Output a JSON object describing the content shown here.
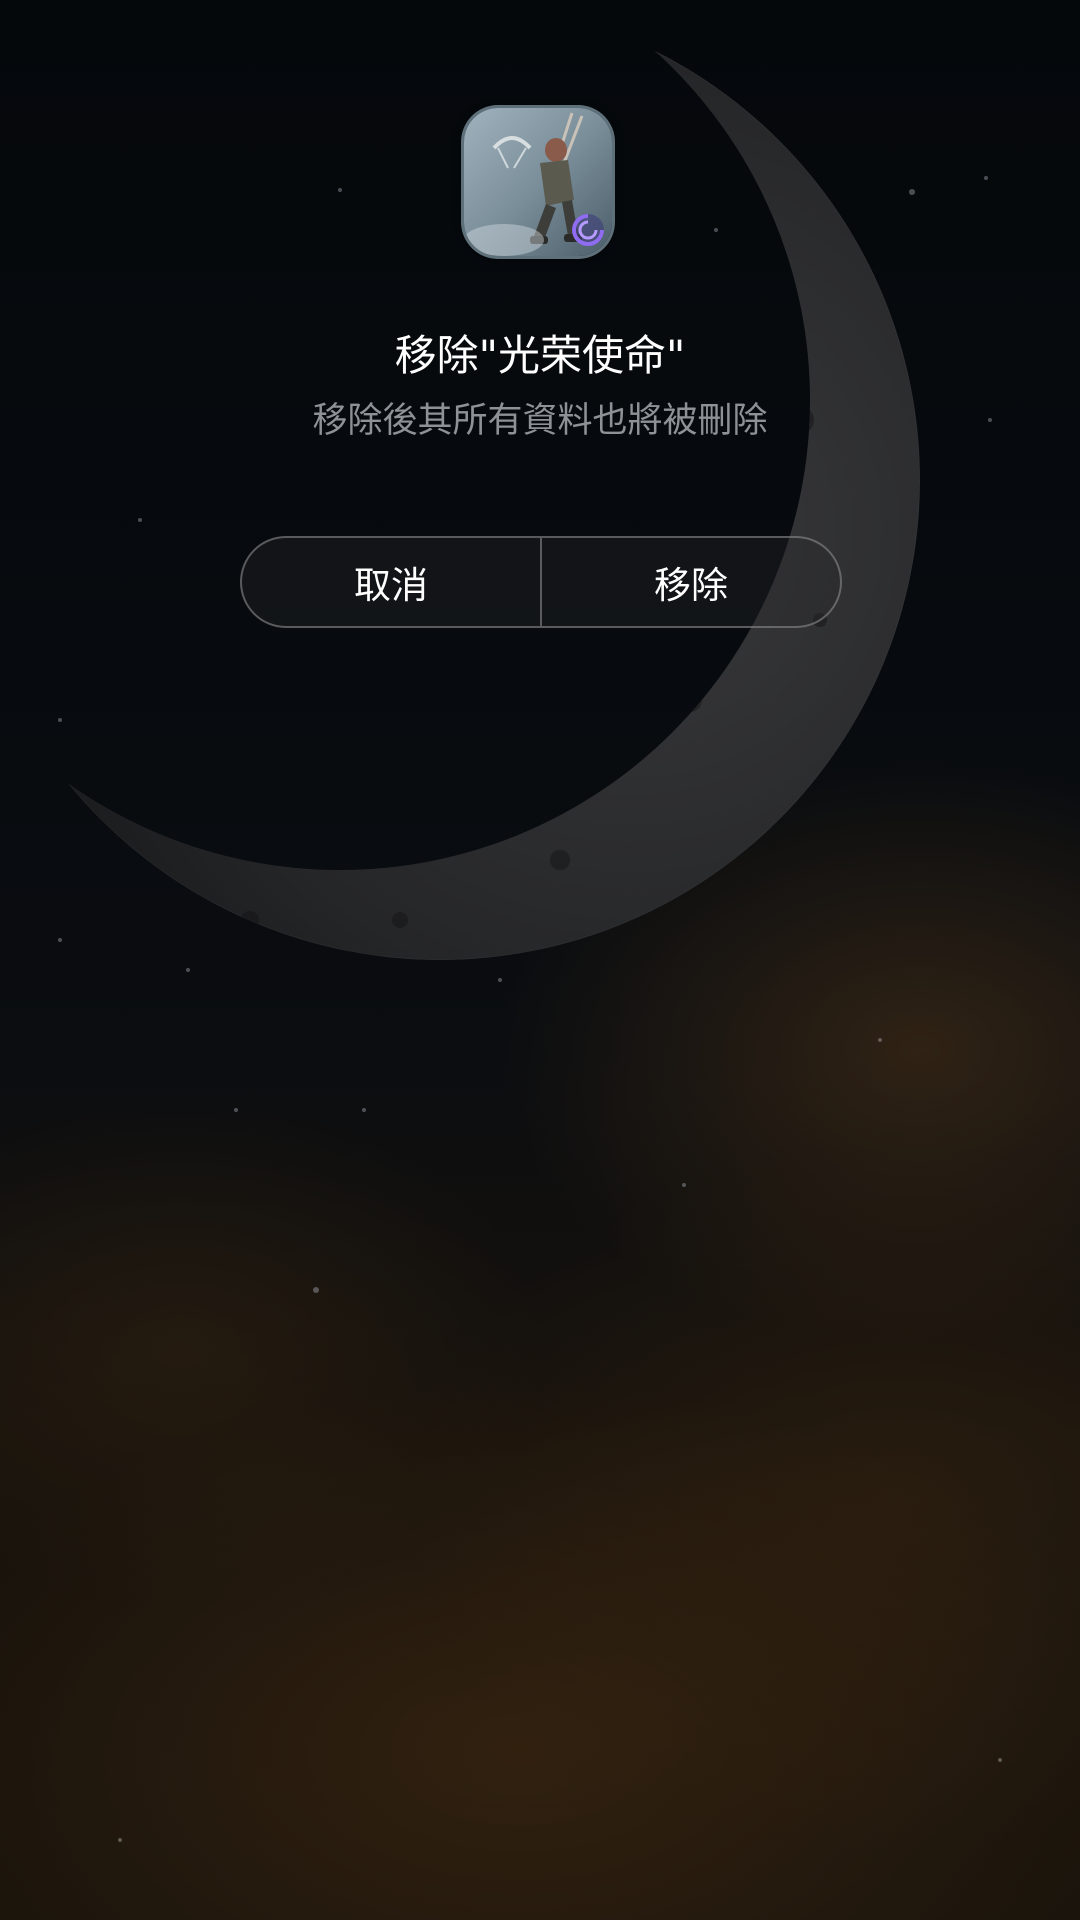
{
  "dialog": {
    "app_icon": "game-app-icon",
    "title": "移除\"光荣使命\"",
    "subtitle": "移除後其所有資料也將被刪除",
    "cancel_label": "取消",
    "remove_label": "移除"
  },
  "background": {
    "description_icon": "night-sky-moon-wallpaper"
  }
}
